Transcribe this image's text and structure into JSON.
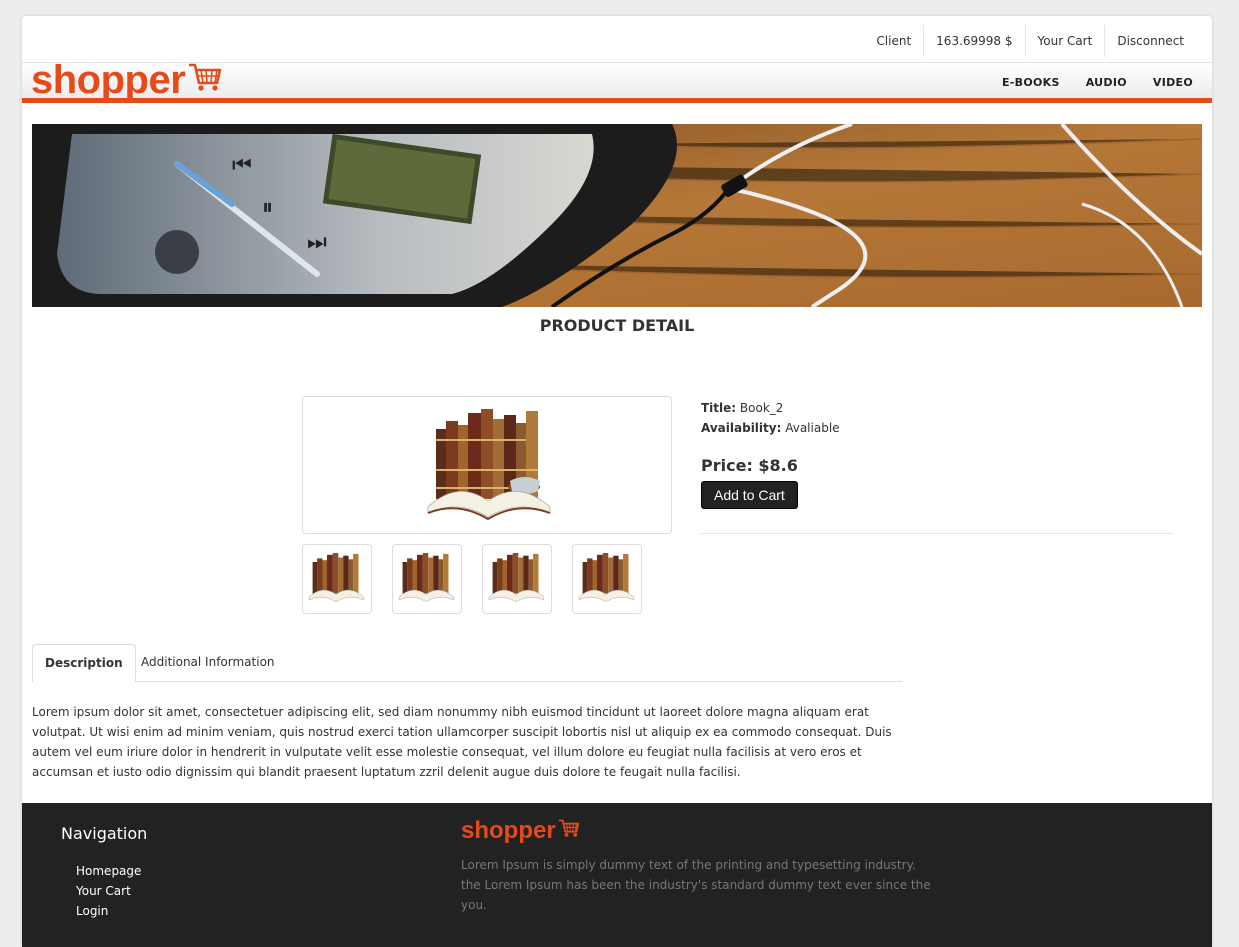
{
  "topbar": {
    "items": [
      "Client",
      "163.69998 $",
      "Your Cart",
      "Disconnect"
    ]
  },
  "header": {
    "logo_text": "shopper",
    "logo_icon": "shopping-cart-icon",
    "nav": [
      "E-BOOKS",
      "AUDIO",
      "VIDEO"
    ]
  },
  "banner": {
    "image": "phone-music-player-with-earphones"
  },
  "page_title": "PRODUCT DETAIL",
  "product": {
    "image": "book-stack-icon",
    "thumbnails": [
      "book-stack-icon",
      "book-stack-icon",
      "book-stack-icon",
      "book-stack-icon"
    ],
    "title_label": "Title:",
    "title_value": "Book_2",
    "availability_label": "Availability:",
    "availability_value": "Avaliable",
    "price_text": "Price: $8.6",
    "add_to_cart": "Add to Cart"
  },
  "tabs": [
    "Description",
    "Additional Information"
  ],
  "description": "Lorem ipsum dolor sit amet, consectetuer adipiscing elit, sed diam nonummy nibh euismod tincidunt ut laoreet dolore magna aliquam erat volutpat. Ut wisi enim ad minim veniam, quis nostrud exerci tation ullamcorper suscipit lobortis nisl ut aliquip ex ea commodo consequat. Duis autem vel eum iriure dolor in hendrerit in vulputate velit esse molestie consequat, vel illum dolore eu feugiat nulla facilisis at vero eros et accumsan et iusto odio dignissim qui blandit praesent luptatum zzril delenit augue duis dolore te feugait nulla facilisi.",
  "footer": {
    "nav_title": "Navigation",
    "nav_items": [
      "Homepage",
      "Your Cart",
      "Login"
    ],
    "logo_text": "shopper",
    "about": "Lorem Ipsum is simply dummy text of the printing and typesetting industry. the Lorem Ipsum has been the industry's standard dummy text ever since the you."
  },
  "colors": {
    "accent": "#e64a19",
    "footer_bg": "#222222",
    "button_bg": "#222222"
  }
}
